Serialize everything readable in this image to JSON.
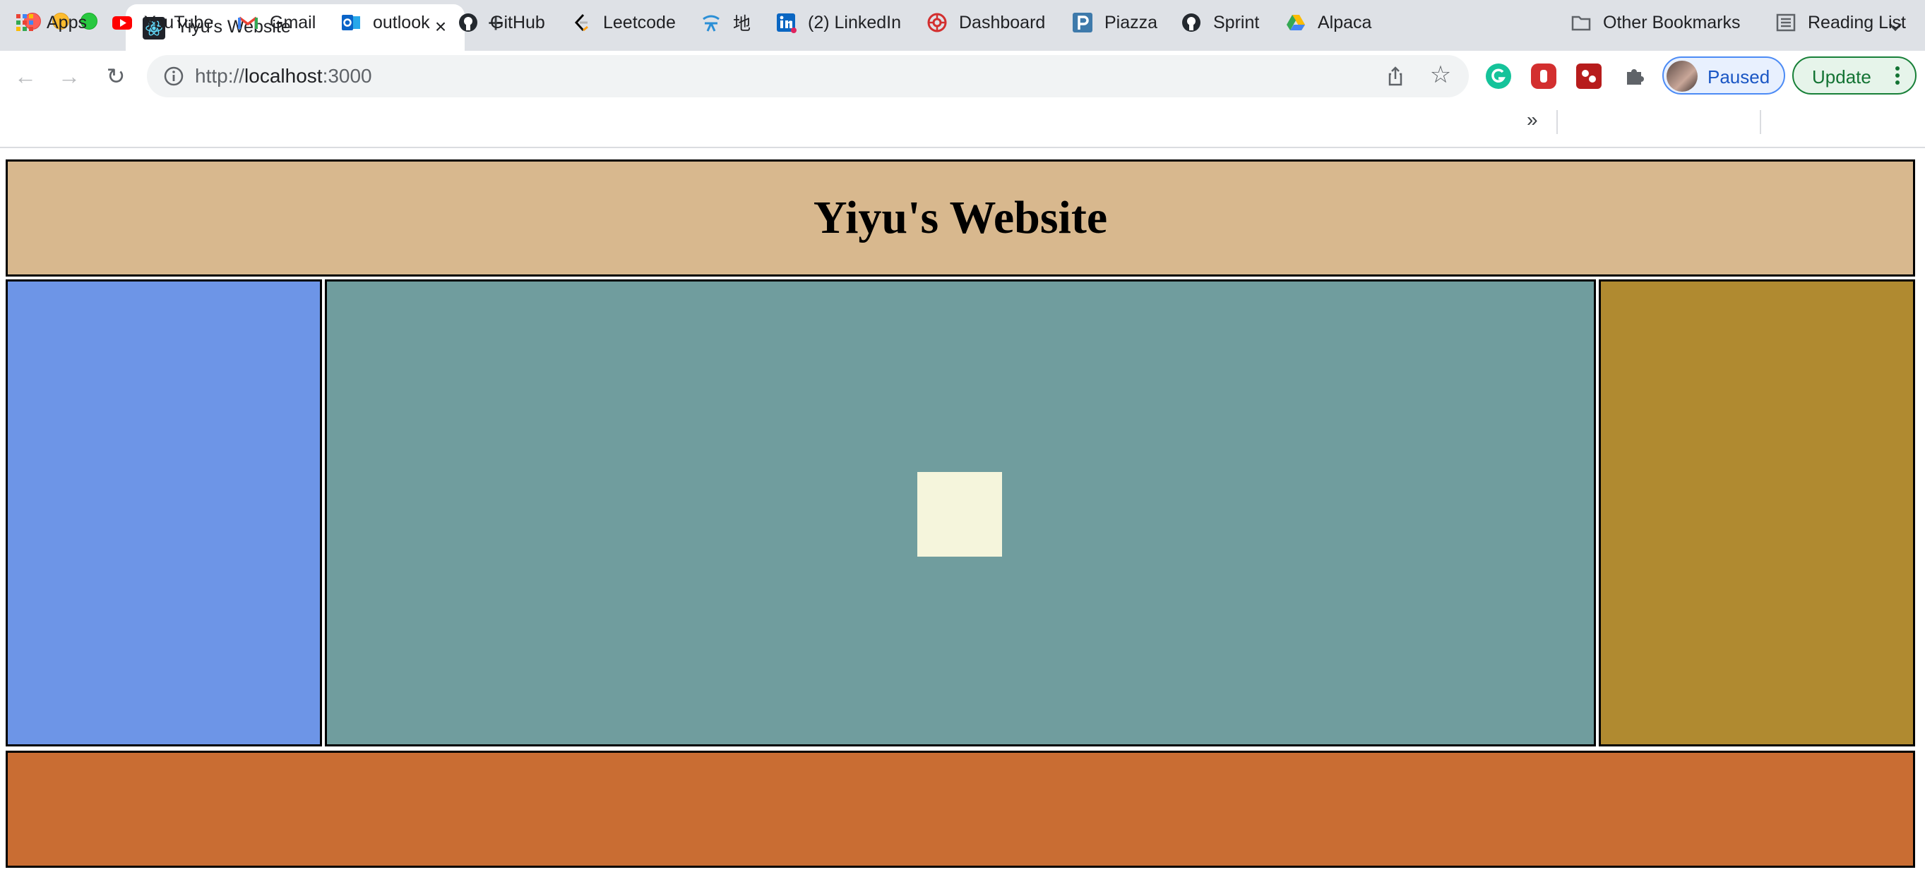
{
  "browser": {
    "tab": {
      "title": "Yiyu's Website",
      "close_glyph": "×",
      "favicon": "react-icon"
    },
    "new_tab_glyph": "+",
    "nav": {
      "back_glyph": "←",
      "forward_glyph": "→",
      "reload_glyph": "↻"
    },
    "omnibox": {
      "scheme": "http://",
      "host": "localhost",
      "port": ":3000",
      "star_glyph": "☆"
    },
    "extensions": [
      "grammarly-icon",
      "adblock-icon",
      "extension-red-icon",
      "puzzle-icon"
    ],
    "profile": {
      "label": "Paused"
    },
    "update": {
      "label": "Update"
    },
    "bookmarks": {
      "items": [
        {
          "label": "Apps",
          "icon": "apps-grid-icon"
        },
        {
          "label": "YouTube",
          "icon": "youtube-icon"
        },
        {
          "label": "Gmail",
          "icon": "gmail-icon"
        },
        {
          "label": "outlook",
          "icon": "outlook-icon"
        },
        {
          "label": "GitHub",
          "icon": "github-icon"
        },
        {
          "label": "Leetcode",
          "icon": "leetcode-icon"
        },
        {
          "label": "地",
          "icon": "map-icon"
        },
        {
          "label": "(2) LinkedIn",
          "icon": "linkedin-icon"
        },
        {
          "label": "Dashboard",
          "icon": "dashboard-icon"
        },
        {
          "label": "Piazza",
          "icon": "piazza-icon"
        },
        {
          "label": "Sprint",
          "icon": "github-icon"
        },
        {
          "label": "Alpaca",
          "icon": "google-drive-icon"
        }
      ],
      "more_glyph": "»",
      "other": "Other Bookmarks",
      "reading_list": "Reading List"
    }
  },
  "page": {
    "title": "Yiyu's Website",
    "colors": {
      "header": "#d8b88e",
      "left_sidebar": "#6d95e7",
      "main": "#709d9e",
      "center_square": "#f5f5dc",
      "right_sidebar": "#b08a30",
      "footer": "#c96d33"
    }
  }
}
